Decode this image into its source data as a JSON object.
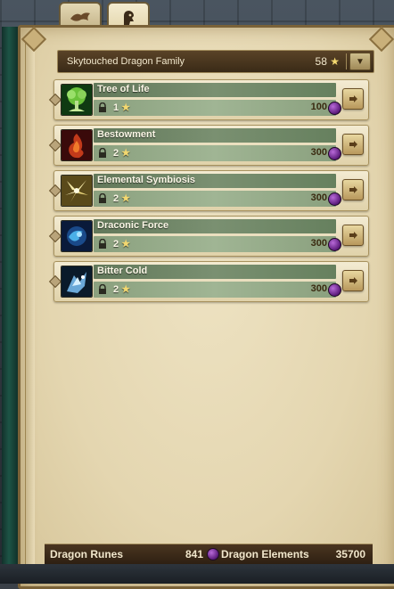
{
  "tabs": [
    {
      "icon": "dragon-icon",
      "active": false
    },
    {
      "icon": "dragon-head-icon",
      "active": true
    }
  ],
  "header": {
    "family_name": "Skytouched Dragon Family",
    "star_count": "58",
    "star_symbol": "★"
  },
  "runes": [
    {
      "name": "Tree of Life",
      "level": "1",
      "cost": "100",
      "icon": "tree-icon"
    },
    {
      "name": "Bestowment",
      "level": "2",
      "cost": "300",
      "icon": "fire-icon"
    },
    {
      "name": "Elemental Symbiosis",
      "level": "2",
      "cost": "300",
      "icon": "leaf-burst-icon"
    },
    {
      "name": "Draconic Force",
      "level": "2",
      "cost": "300",
      "icon": "blue-swirl-icon"
    },
    {
      "name": "Bitter Cold",
      "level": "2",
      "cost": "300",
      "icon": "frost-icon"
    }
  ],
  "footer": {
    "runes_label": "Dragon Runes",
    "runes_value": "841",
    "elements_label": "Dragon Elements",
    "elements_value": "35700"
  },
  "colors": {
    "accent_star": "#f3d870",
    "orb_purple": "#8a3ab0"
  }
}
